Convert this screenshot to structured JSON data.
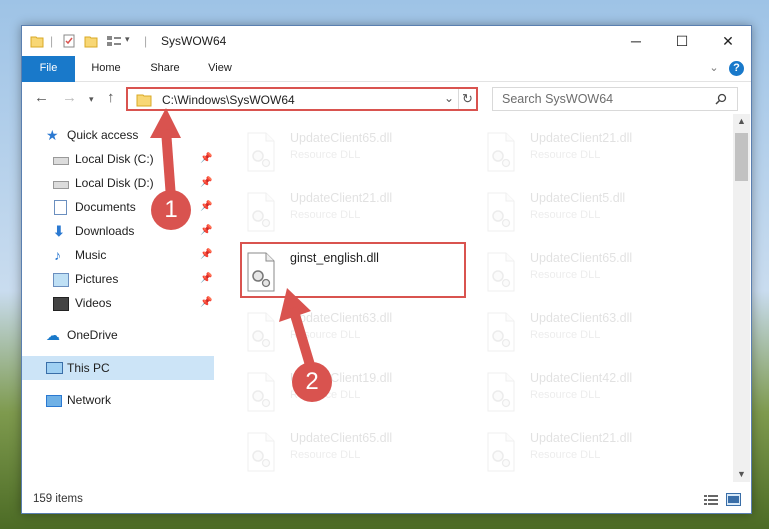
{
  "window": {
    "title": "SysWOW64",
    "minimize_glyph": "─",
    "maximize_glyph": "☐",
    "close_glyph": "✕"
  },
  "ribbon": {
    "tabs": [
      "File",
      "Home",
      "Share",
      "View"
    ],
    "help_glyph": "?",
    "expand_glyph": "⌄"
  },
  "address": {
    "path": "C:\\Windows\\SysWOW64",
    "search_placeholder": "Search SysWOW64"
  },
  "sidebar": {
    "quick_access": "Quick access",
    "pinned": [
      "Local Disk (C:)",
      "Local Disk (D:)",
      "Documents",
      "Downloads",
      "Music",
      "Pictures",
      "Videos"
    ],
    "onedrive": "OneDrive",
    "this_pc": "This PC",
    "network": "Network"
  },
  "files": {
    "left": [
      {
        "name": "UpdateClient65.dll",
        "type": "Resource DLL"
      },
      {
        "name": "UpdateClient21.dll",
        "type": "Resource DLL"
      },
      {
        "name": "ginst_english.dll",
        "type": ""
      },
      {
        "name": "UpdateClient63.dll",
        "type": "Resource DLL"
      },
      {
        "name": "UpdateClient19.dll",
        "type": "Resource DLL"
      },
      {
        "name": "UpdateClient65.dll",
        "type": "Resource DLL"
      }
    ],
    "right": [
      {
        "name": "UpdateClient21.dll",
        "type": "Resource DLL"
      },
      {
        "name": "UpdateClient5.dll",
        "type": "Resource DLL"
      },
      {
        "name": "UpdateClient65.dll",
        "type": "Resource DLL"
      },
      {
        "name": "UpdateClient63.dll",
        "type": "Resource DLL"
      },
      {
        "name": "UpdateClient42.dll",
        "type": "Resource DLL"
      },
      {
        "name": "UpdateClient21.dll",
        "type": "Resource DLL"
      }
    ]
  },
  "status": {
    "items": "159 items"
  },
  "annotations": {
    "step1": "1",
    "step2": "2"
  },
  "colors": {
    "accent": "#1979ca",
    "highlight": "#d9534f",
    "selection": "#cce4f7"
  }
}
